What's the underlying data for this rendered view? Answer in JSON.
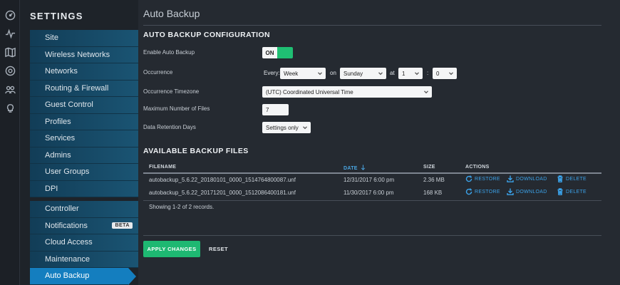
{
  "rail_icons": [
    "dashboard-icon",
    "statistics-icon",
    "map-icon",
    "devices-icon",
    "clients-icon",
    "insights-icon"
  ],
  "settings": {
    "title": "SETTINGS",
    "items": [
      {
        "label": "Site"
      },
      {
        "label": "Wireless Networks"
      },
      {
        "label": "Networks"
      },
      {
        "label": "Routing & Firewall"
      },
      {
        "label": "Guest Control"
      },
      {
        "label": "Profiles"
      },
      {
        "label": "Services"
      },
      {
        "label": "Admins"
      },
      {
        "label": "User Groups"
      },
      {
        "label": "DPI"
      },
      {
        "label": "Controller"
      },
      {
        "label": "Notifications",
        "badge": "BETA"
      },
      {
        "label": "Cloud Access"
      },
      {
        "label": "Maintenance"
      },
      {
        "label": "Auto Backup",
        "active": true
      }
    ]
  },
  "page": {
    "title": "Auto Backup",
    "config_heading": "AUTO BACKUP CONFIGURATION",
    "fields": {
      "enable_label": "Enable Auto Backup",
      "enable_value": "ON",
      "occurrence_label": "Occurrence",
      "every_label": "Every:",
      "every_value": "Week",
      "on_label": "on",
      "day_value": "Sunday",
      "at_label": "at",
      "hour_value": "1",
      "colon": ":",
      "minute_value": "0",
      "timezone_label": "Occurrence Timezone",
      "timezone_value": "(UTC) Coordinated Universal Time",
      "max_files_label": "Maximum Number of Files",
      "max_files_value": "7",
      "retention_label": "Data Retention Days",
      "retention_value": "Settings only"
    },
    "files_heading": "AVAILABLE BACKUP FILES",
    "table": {
      "headers": {
        "filename": "FILENAME",
        "date": "DATE",
        "size": "SIZE",
        "actions": "ACTIONS"
      },
      "rows": [
        {
          "filename": "autobackup_5.6.22_20180101_0000_1514764800087.unf",
          "date": "12/31/2017 6:00 pm",
          "size": "2.36 MB"
        },
        {
          "filename": "autobackup_5.6.22_20171201_0000_1512086400181.unf",
          "date": "11/30/2017 6:00 pm",
          "size": "168 KB"
        }
      ],
      "action_labels": {
        "restore": "RESTORE",
        "download": "DOWNLOAD",
        "delete": "DELETE"
      },
      "records_text": "Showing 1-2 of 2 records."
    },
    "apply_label": "APPLY CHANGES",
    "reset_label": "RESET"
  },
  "colors": {
    "accent": "#147ebf",
    "success": "#1eb872",
    "link": "#3ba3ea",
    "background": "#252a31"
  }
}
